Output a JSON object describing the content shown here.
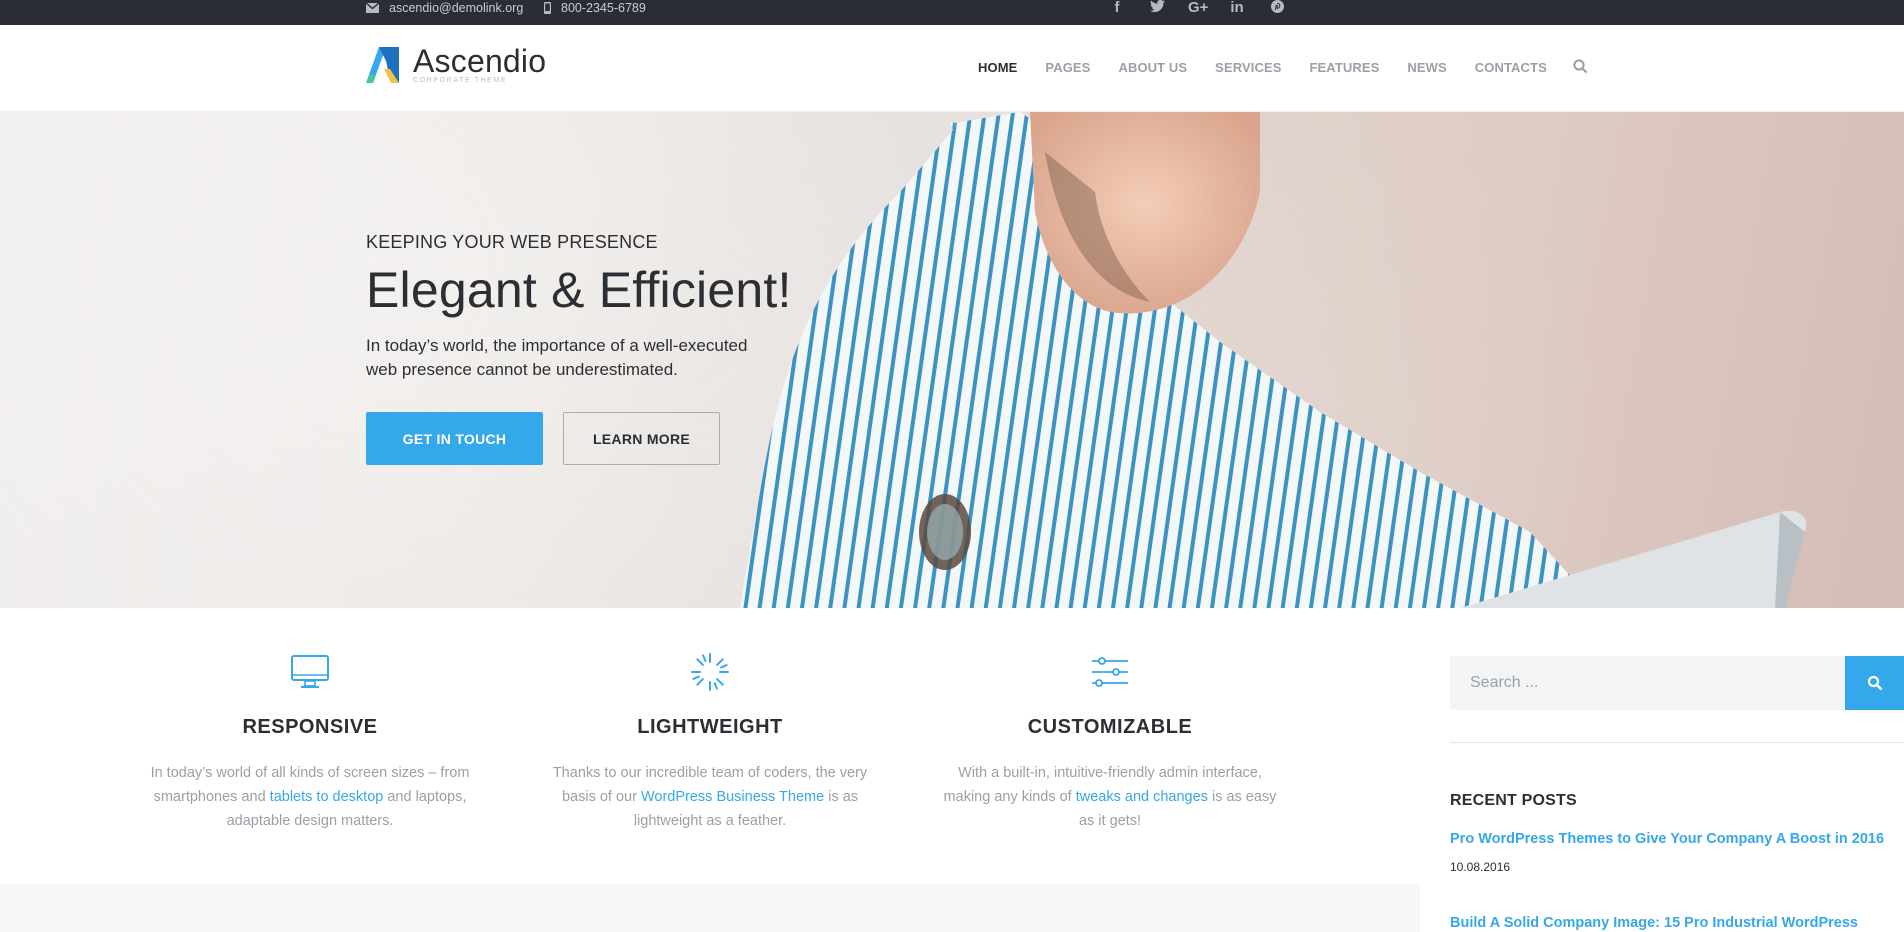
{
  "topbar": {
    "email": "ascendio@demolink.org",
    "phone": "800-2345-6789",
    "social": [
      {
        "name": "facebook-icon",
        "glyph": "f"
      },
      {
        "name": "twitter-icon",
        "glyph": "t"
      },
      {
        "name": "google-plus-icon",
        "glyph": "G+"
      },
      {
        "name": "linkedin-icon",
        "glyph": "in"
      },
      {
        "name": "pinterest-icon",
        "glyph": "p"
      }
    ]
  },
  "header": {
    "logo_title": "Ascendio",
    "logo_tagline": "CORPORATE THEME",
    "nav": [
      "HOME",
      "PAGES",
      "ABOUT US",
      "SERVICES",
      "FEATURES",
      "NEWS",
      "CONTACTS"
    ],
    "active_nav": "HOME"
  },
  "hero": {
    "kicker": "KEEPING YOUR WEB PRESENCE",
    "title": "Elegant & Efficient!",
    "description": "In today’s world, the importance of a well-executed web presence cannot be underestimated.",
    "primary_button": "GET IN TOUCH",
    "secondary_button": "LEARN MORE"
  },
  "features": [
    {
      "icon": "monitor-icon",
      "title": "RESPONSIVE",
      "text_before": "In today’s world of all kinds of screen sizes – from smartphones and ",
      "link": "tablets to desktop",
      "text_after": " and laptops, adaptable design matters."
    },
    {
      "icon": "loader-icon",
      "title": "LIGHTWEIGHT",
      "text_before": "Thanks to our incredible team of coders, the very basis of our ",
      "link": "WordPress Business Theme",
      "text_after": " is as lightweight as a feather."
    },
    {
      "icon": "sliders-icon",
      "title": "CUSTOMIZABLE",
      "text_before": "With a built-in, intuitive-friendly admin interface, making any kinds of ",
      "link": "tweaks and changes",
      "text_after": " is as easy as it gets!"
    }
  ],
  "sidebar": {
    "search_placeholder": "Search ...",
    "recent_title": "RECENT POSTS",
    "posts": [
      {
        "title": "Pro WordPress Themes to Give Your Company A Boost in 2016",
        "date": "10.08.2016"
      },
      {
        "title": "Build A Solid Company Image: 15 Pro Industrial WordPress"
      }
    ]
  },
  "colors": {
    "accent": "#35a7eb",
    "dark": "#2a2d33",
    "muted": "#9aa0a8"
  }
}
